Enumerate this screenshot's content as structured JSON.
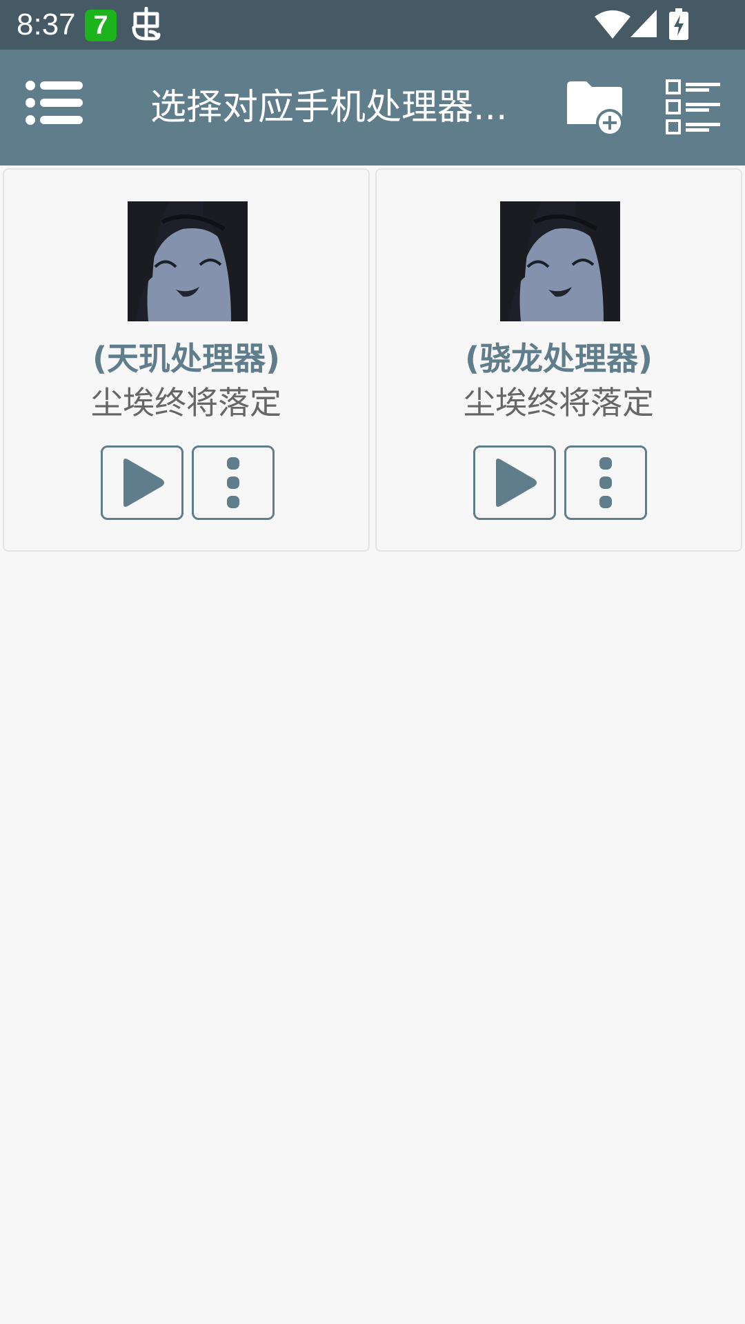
{
  "status_bar": {
    "time": "8:37",
    "app_icon_text": "7",
    "icons": [
      "app-7-icon",
      "bug-icon",
      "wifi-icon",
      "signal-icon",
      "battery-charging-icon"
    ]
  },
  "app_bar": {
    "title": "选择对应手机处理器...",
    "menu_icon": "menu-list-icon",
    "action_icons": [
      "folder-add-icon",
      "list-view-icon"
    ]
  },
  "cards": [
    {
      "title": "(天玑处理器)",
      "subtitle": "尘埃终将落定",
      "buttons": [
        "play-icon",
        "more-vert-icon"
      ]
    },
    {
      "title": "(骁龙处理器)",
      "subtitle": "尘埃终将落定",
      "buttons": [
        "play-icon",
        "more-vert-icon"
      ]
    }
  ],
  "colors": {
    "status_bar": "#455a64",
    "app_bar": "#607d8b",
    "accent": "#607d8b",
    "background": "#f7f7f7",
    "subtitle": "#666666"
  }
}
